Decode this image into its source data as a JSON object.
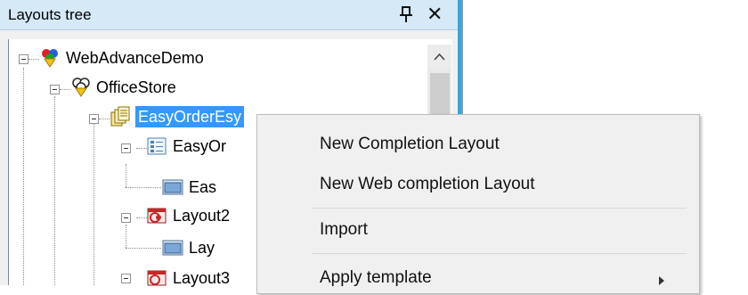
{
  "panel": {
    "title": "Layouts tree",
    "pin_glyph": "ɂ",
    "close_glyph": "✕"
  },
  "tree": {
    "nodes": [
      {
        "label": "WebAdvanceDemo",
        "icon": "app-tricolor-icon"
      },
      {
        "label": "OfficeStore",
        "icon": "store-outline-icon"
      },
      {
        "label": "EasyOrderEsy",
        "icon": "pages-stack-icon",
        "selected": true
      },
      {
        "label": "EasyOr",
        "icon": "form-list-icon"
      },
      {
        "label": "Eas",
        "icon": "window-icon"
      },
      {
        "label": "Layout2",
        "icon": "red-layout-icon"
      },
      {
        "label": "Lay",
        "icon": "window-icon"
      },
      {
        "label": "Layout3",
        "icon": "red-layout-icon"
      }
    ]
  },
  "context_menu": {
    "items": [
      {
        "label": "New Completion Layout"
      },
      {
        "label": "New Web completion Layout"
      },
      {
        "label": "Import"
      },
      {
        "label": "Apply template",
        "has_submenu": true
      }
    ]
  },
  "colors": {
    "header_bg": "#d6e9f7",
    "accent": "#3aa5d6",
    "selection": "#3399ff"
  }
}
